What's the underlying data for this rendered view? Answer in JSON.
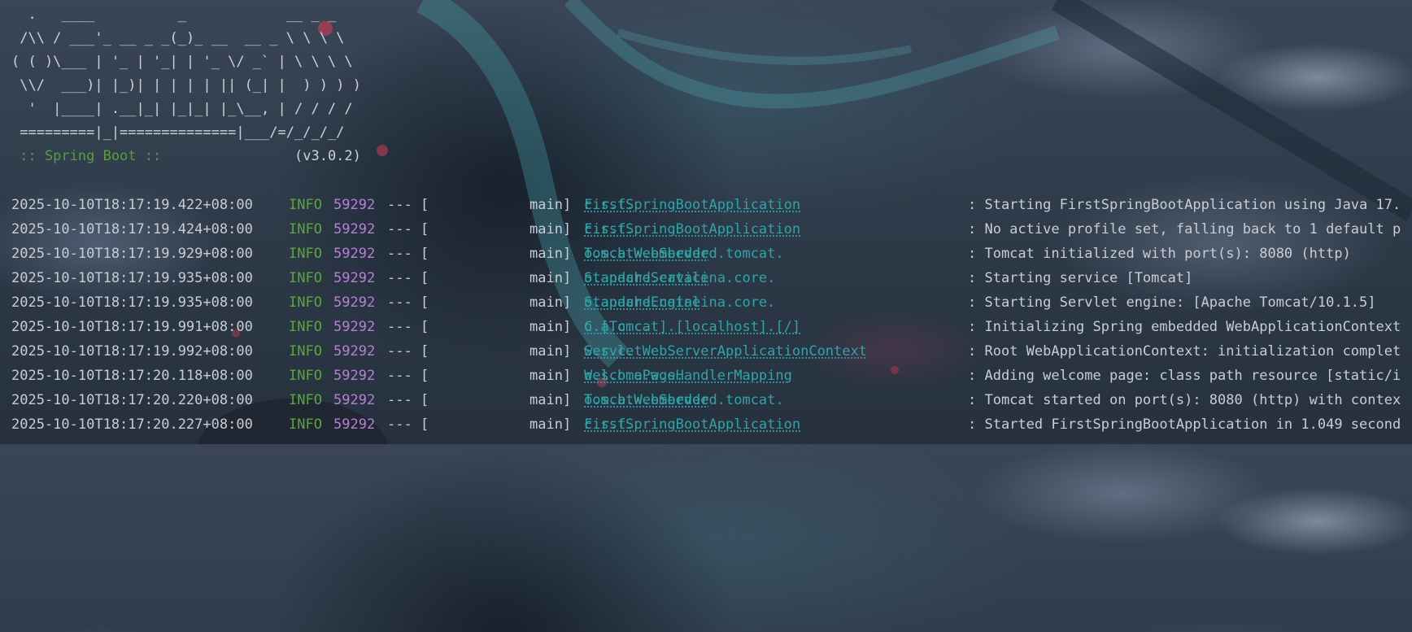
{
  "banner": {
    "lines": [
      "  .   ____          _            __ _ _",
      " /\\\\ / ___'_ __ _ _(_)_ __  __ _ \\ \\ \\ \\",
      "( ( )\\___ | '_ | '_| | '_ \\/ _` | \\ \\ \\ \\",
      " \\\\/  ___)| |_)| | | | | || (_| |  ) ) ) )",
      "  '  |____| .__|_| |_|_| |_\\__, | / / / /",
      " =========|_|==============|___/=/_/_/_/"
    ],
    "boot_label": " :: Spring Boot ::",
    "boot_version": "(v3.0.2)"
  },
  "log_rows": [
    {
      "timestamp": "2025-10-10T18:17:19.422+08:00",
      "level": "INFO",
      "pid": "59292",
      "sep": "--- [",
      "thread": "main]",
      "logger_pkg": "c.s.f.",
      "logger_cls": "FirstSpringBootApplication",
      "message": ": Starting FirstSpringBootApplication using Java 17."
    },
    {
      "timestamp": "2025-10-10T18:17:19.424+08:00",
      "level": "INFO",
      "pid": "59292",
      "sep": "--- [",
      "thread": "main]",
      "logger_pkg": "c.s.f.",
      "logger_cls": "FirstSpringBootApplication",
      "message": ": No active profile set, falling back to 1 default p"
    },
    {
      "timestamp": "2025-10-10T18:17:19.929+08:00",
      "level": "INFO",
      "pid": "59292",
      "sep": "--- [",
      "thread": "main]",
      "logger_pkg": "o.s.b.w.embedded.tomcat.",
      "logger_cls": "TomcatWebServer",
      "message": ": Tomcat initialized with port(s): 8080 (http)"
    },
    {
      "timestamp": "2025-10-10T18:17:19.935+08:00",
      "level": "INFO",
      "pid": "59292",
      "sep": "--- [",
      "thread": "main]",
      "logger_pkg": "o.apache.catalina.core.",
      "logger_cls": "StandardService",
      "message": ": Starting service [Tomcat]"
    },
    {
      "timestamp": "2025-10-10T18:17:19.935+08:00",
      "level": "INFO",
      "pid": "59292",
      "sep": "--- [",
      "thread": "main]",
      "logger_pkg": "o.apache.catalina.core.",
      "logger_cls": "StandardEngine",
      "message": ": Starting Servlet engine: [Apache Tomcat/10.1.5]"
    },
    {
      "timestamp": "2025-10-10T18:17:19.991+08:00",
      "level": "INFO",
      "pid": "59292",
      "sep": "--- [",
      "thread": "main]",
      "logger_pkg": "o.a.c.c.",
      "logger_cls": "C.[Tomcat].[localhost].[/]",
      "message": ": Initializing Spring embedded WebApplicationContext"
    },
    {
      "timestamp": "2025-10-10T18:17:19.992+08:00",
      "level": "INFO",
      "pid": "59292",
      "sep": "--- [",
      "thread": "main]",
      "logger_pkg": "w.s.c.",
      "logger_cls": "ServletWebServerApplicationContext",
      "message": ": Root WebApplicationContext: initialization complet"
    },
    {
      "timestamp": "2025-10-10T18:17:20.118+08:00",
      "level": "INFO",
      "pid": "59292",
      "sep": "--- [",
      "thread": "main]",
      "logger_pkg": "o.s.b.a.w.s.",
      "logger_cls": "WelcomePageHandlerMapping",
      "message": ": Adding welcome page: class path resource [static/i"
    },
    {
      "timestamp": "2025-10-10T18:17:20.220+08:00",
      "level": "INFO",
      "pid": "59292",
      "sep": "--- [",
      "thread": "main]",
      "logger_pkg": "o.s.b.w.embedded.tomcat.",
      "logger_cls": "TomcatWebServer",
      "message": ": Tomcat started on port(s): 8080 (http) with contex"
    },
    {
      "timestamp": "2025-10-10T18:17:20.227+08:00",
      "level": "INFO",
      "pid": "59292",
      "sep": "--- [",
      "thread": "main]",
      "logger_pkg": "c.s.f.",
      "logger_cls": "FirstSpringBootApplication",
      "message": ": Started FirstSpringBootApplication in 1.049 second"
    }
  ]
}
